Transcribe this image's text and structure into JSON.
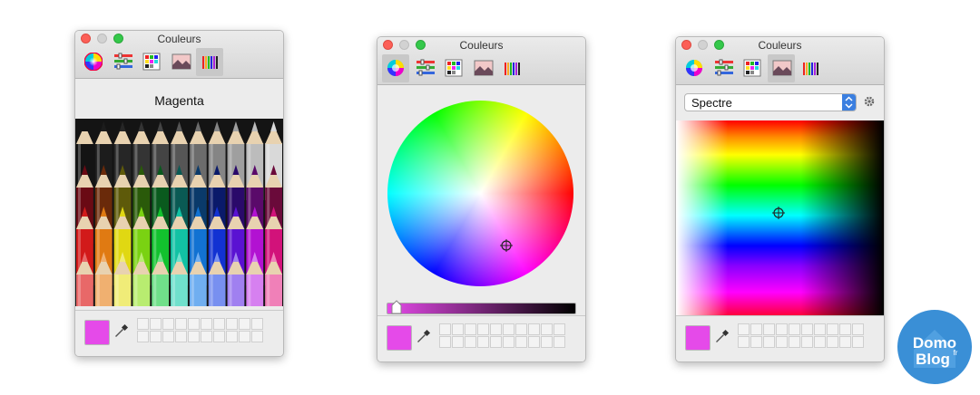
{
  "windows": [
    {
      "title": "Couleurs",
      "mode": "crayons",
      "selected_color_name": "Magenta"
    },
    {
      "title": "Couleurs",
      "mode": "roue de couleurs"
    },
    {
      "title": "Couleurs",
      "mode": "palettes d'images",
      "palette_popup": "Spectre"
    }
  ],
  "current_color": "#e54ae9",
  "logo": {
    "line1": "Domo",
    "line2": "Blog",
    "suffix": "fr"
  },
  "pencil_colors": [
    [
      "#141414",
      "#1c1c1c",
      "#262626",
      "#343434",
      "#444444",
      "#565656",
      "#6c6c6c",
      "#858585",
      "#9f9f9f",
      "#bcbcbc",
      "#d9d9d9"
    ],
    [
      "#6a0a14",
      "#6a2a0a",
      "#5e5a0a",
      "#2a5a0a",
      "#0a5a1e",
      "#0a5a54",
      "#0a3a6a",
      "#0a1a6a",
      "#2a0a6a",
      "#5a0a6a",
      "#6a0a3a"
    ],
    [
      "#d21a1a",
      "#e07a12",
      "#e0d812",
      "#7ad212",
      "#12c22e",
      "#12c2a4",
      "#1272d2",
      "#1232d2",
      "#5a12d2",
      "#b212d2",
      "#d2127a"
    ],
    [
      "#e86868",
      "#f0b070",
      "#f0ec78",
      "#b8ec70",
      "#70e08a",
      "#70e0cc",
      "#70aef0",
      "#7890f0",
      "#a080f0",
      "#d680f0",
      "#f080b8"
    ]
  ]
}
